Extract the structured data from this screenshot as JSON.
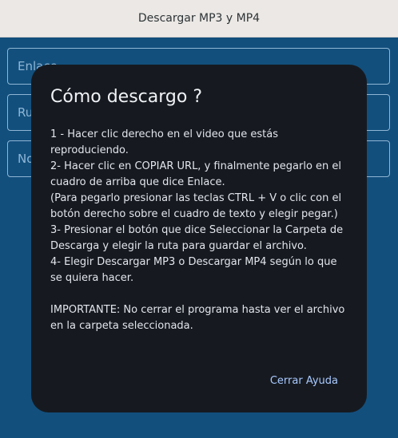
{
  "window": {
    "title": "Descargar MP3 y MP4"
  },
  "background_fields": {
    "link_placeholder": "Enlace",
    "route_placeholder": "Ruta",
    "name_placeholder": "Nombre"
  },
  "dialog": {
    "title": "Cómo descargo ?",
    "body": "1 - Hacer clic derecho en el video que estás\nreproduciendo.\n2- Hacer clic en COPIAR URL, y finalmente pegarlo en el\ncuadro de arriba que dice Enlace.\n(Para pegarlo presionar las teclas CTRL + V o clic con el\nbotón derecho sobre el cuadro de texto y elegir pegar.)\n3- Presionar el botón que dice Seleccionar la Carpeta de\nDescarga y elegir la ruta para guardar el archivo.\n4- Elegir Descargar MP3 o Descargar MP4 según lo que\nse quiera hacer.\n\nIMPORTANTE: No cerrar el programa hasta ver el archivo\nen la carpeta seleccionada.",
    "close_button": "Cerrar Ayuda"
  },
  "colors": {
    "window_background": "#124f7d",
    "dialog_background": "#161a20",
    "accent_link": "#a9c9ff"
  }
}
